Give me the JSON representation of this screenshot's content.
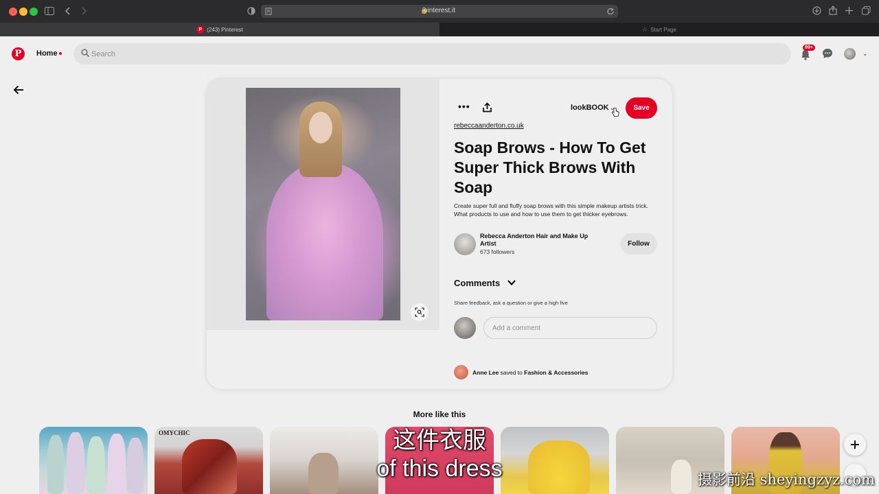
{
  "browser": {
    "url": "pinterest.it",
    "tabs": [
      {
        "label": "(243) Pinterest",
        "active": true
      },
      {
        "label": "Start Page",
        "active": false
      }
    ]
  },
  "header": {
    "home_label": "Home",
    "search_placeholder": "Search",
    "notification_count": "99+",
    "brand_color": "#e60023"
  },
  "pin": {
    "board_name": "lookBOOK",
    "save_label": "Save",
    "source_link": "rebeccaanderton.co.uk",
    "title": "Soap Brows - How To Get Super Thick Brows With Soap",
    "description": "Create super full and fluffy soap brows with this simple makeup artists trick. What products to use and how to use them to get thicker eyebrows.",
    "creator_name": "Rebecca Anderton Hair and Make Up Artist",
    "creator_followers": "673 followers",
    "follow_label": "Follow",
    "comments_heading": "Comments",
    "comments_hint": "Share feedback, ask a question or give a high five",
    "comment_placeholder": "Add a comment",
    "saved_by": "Anne Lee",
    "saved_to_text": "saved to",
    "saved_board": "Fashion & Accessories"
  },
  "more": {
    "heading": "More like this",
    "thumb2_caption": "OMYCHIC"
  },
  "overlay": {
    "subtitle_cn": "这件衣服",
    "subtitle_en": "of this dress",
    "watermark": "摄影前沿 sheyingzyz.com"
  }
}
